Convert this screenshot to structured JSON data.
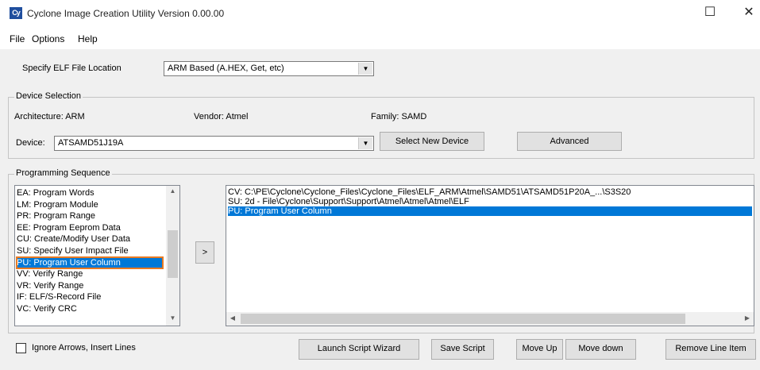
{
  "window": {
    "icon_text": "Cy",
    "title": "Cyclone Image Creation Utility Version 0.00.00",
    "maximize_glyph": "☐",
    "close_glyph": "✕"
  },
  "menu": {
    "file": "File",
    "options": "Options",
    "help": "Help"
  },
  "top": {
    "label": "Specify ELF File Location",
    "combo_value": "ARM Based (A.HEX, Get, etc)"
  },
  "device_selection": {
    "legend": "Device Selection",
    "architecture": "Architecture: ARM",
    "vendor": "Vendor: Atmel",
    "family": "Family: SAMD",
    "device_label": "Device:",
    "device_value": "ATSAMD51J19A",
    "select_new_device": "Select New Device",
    "advanced": "Advanced"
  },
  "programming_sequence": {
    "legend": "Programming Sequence",
    "available_ops": [
      "EA: Program Words",
      "LM: Program Module",
      "PR: Program Range",
      "EE: Program Eeprom Data",
      "CU: Create/Modify User Data",
      "SU: Specify User Impact File",
      "PU: Program User Column",
      "VV: Verify Range",
      "VR: Verify Range",
      "IF: ELF/S-Record File",
      "VC: Verify CRC"
    ],
    "selected_op_index": 6,
    "add_button": ">",
    "sequence": [
      "CV: C:\\PE\\Cyclone\\Cyclone_Files\\Cyclone_Files\\ELF_ARM\\Atmel\\SAMD51\\ATSAMD51P20A_...\\S3S20",
      "SU: 2d - File\\Cyclone\\Support\\Support\\Atmel\\Atmel\\Atmel\\ELF",
      "PU: Program User Column"
    ],
    "selected_seq_index": 2
  },
  "bottom": {
    "checkbox_label": "Ignore Arrows, Insert Lines",
    "launch_script_wizard": "Launch Script Wizard",
    "save_script": "Save Script",
    "move_up": "Move Up",
    "move_down": "Move down",
    "remove_line": "Remove Line Item"
  },
  "colors": {
    "selection": "#0078d7",
    "focus_border": "#e87a22",
    "window_bg": "#f0f0f0"
  }
}
